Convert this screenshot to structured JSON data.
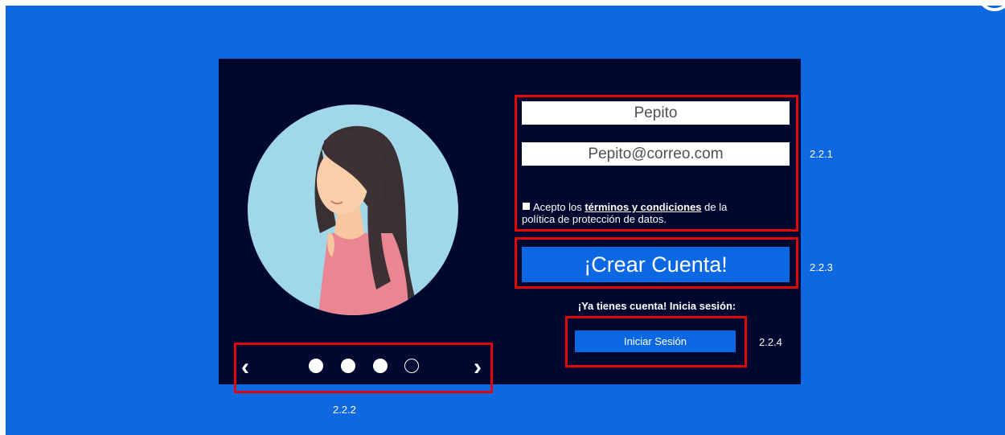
{
  "avatar": {
    "icon": "user-avatar-woman-icon"
  },
  "carousel": {
    "prev_symbol": "‹",
    "next_symbol": "›",
    "active_index": 4,
    "dot_count": 4
  },
  "form": {
    "name_value": "Pepito",
    "email_value": "Pepito@correo.com",
    "terms_prefix": "Acepto los ",
    "terms_link": "términos y condiciones",
    "terms_suffix": " de la política de protección de datos.",
    "create_label": "¡Crear Cuenta!"
  },
  "login": {
    "prompt": "¡Ya tienes cuenta! Inicia sesión:",
    "button_label": "Iniciar Sesión"
  },
  "annotations": {
    "label_221": "2.2.1",
    "label_222": "2.2.2",
    "label_223": "2.2.3",
    "label_224": "2.2.4"
  },
  "colors": {
    "background": "#0e68e2",
    "panel": "#01082f",
    "button": "#0c68e2",
    "highlight": "#e10606"
  }
}
